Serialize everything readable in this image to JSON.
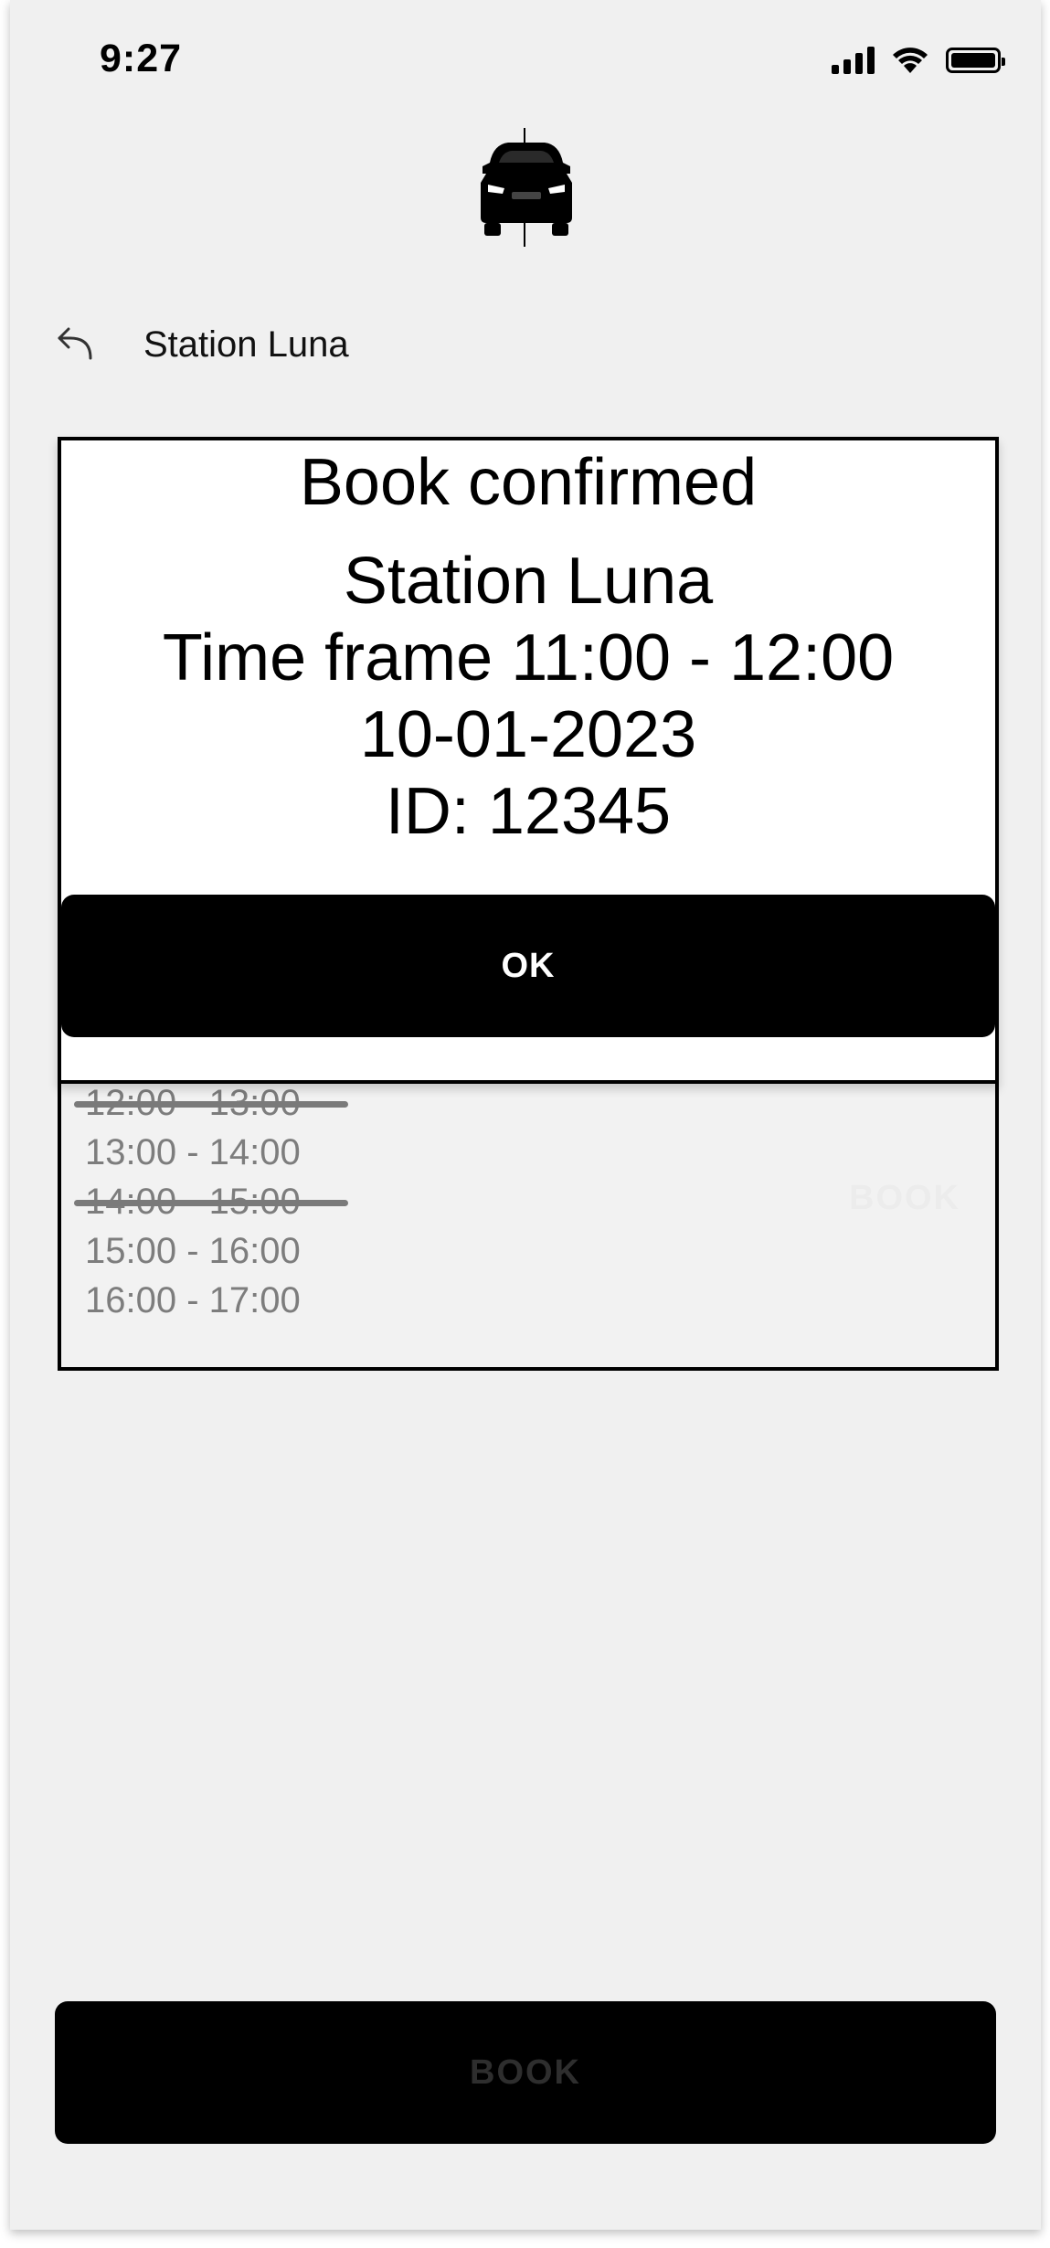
{
  "status_bar": {
    "time": "9:27",
    "icons": [
      "signal-icon",
      "wifi-icon",
      "battery-icon"
    ]
  },
  "logo": {
    "icon": "car-icon"
  },
  "header": {
    "back_icon": "back-arrow-icon",
    "title": "Station Luna"
  },
  "slots": {
    "items": [
      {
        "label": "12:00 - 13:00",
        "available": false
      },
      {
        "label": "13:00 - 14:00",
        "available": true
      },
      {
        "label": "14:00 - 15:00",
        "available": false
      },
      {
        "label": "15:00 - 16:00",
        "available": true
      },
      {
        "label": "16:00 - 17:00",
        "available": true
      }
    ],
    "book_label": "BOOK"
  },
  "modal": {
    "title": "Book confirmed",
    "station": "Station Luna",
    "time_frame": "Time frame 11:00 - 12:00",
    "date": "10-01-2023",
    "id": "ID: 12345",
    "ok_label": "OK"
  },
  "footer": {
    "book_label": "BOOK"
  },
  "colors": {
    "background": "#f0f0f0",
    "primary": "#000000",
    "muted_text": "#7d7d7d"
  }
}
